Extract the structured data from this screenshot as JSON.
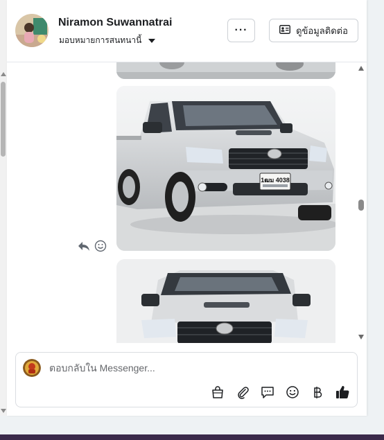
{
  "header": {
    "contact_name": "Niramon Suwannatrai",
    "assign_label": "มอบหมายการสนทนานี้",
    "more_label": "···",
    "contact_info_label": "ดูข้อมูลติดต่อ"
  },
  "conversation": {
    "photos": [
      {
        "desc_icon": "car-photo"
      },
      {
        "plate": "1ฒม 4038"
      },
      {
        "desc_icon": "car-photo"
      }
    ]
  },
  "composer": {
    "placeholder": "ตอบกลับใน Messenger..."
  },
  "colors": {
    "accent": "#1877f2",
    "text": "#1c1e21",
    "border": "#ccd0d5",
    "thumb_icon": "#1c1e21"
  },
  "icons": [
    "ellipsis-icon",
    "contact-card-icon",
    "reply-icon",
    "emoji-icon",
    "bag-icon",
    "paperclip-icon",
    "saved-reply-icon",
    "baht-icon",
    "thumbs-up-icon"
  ]
}
